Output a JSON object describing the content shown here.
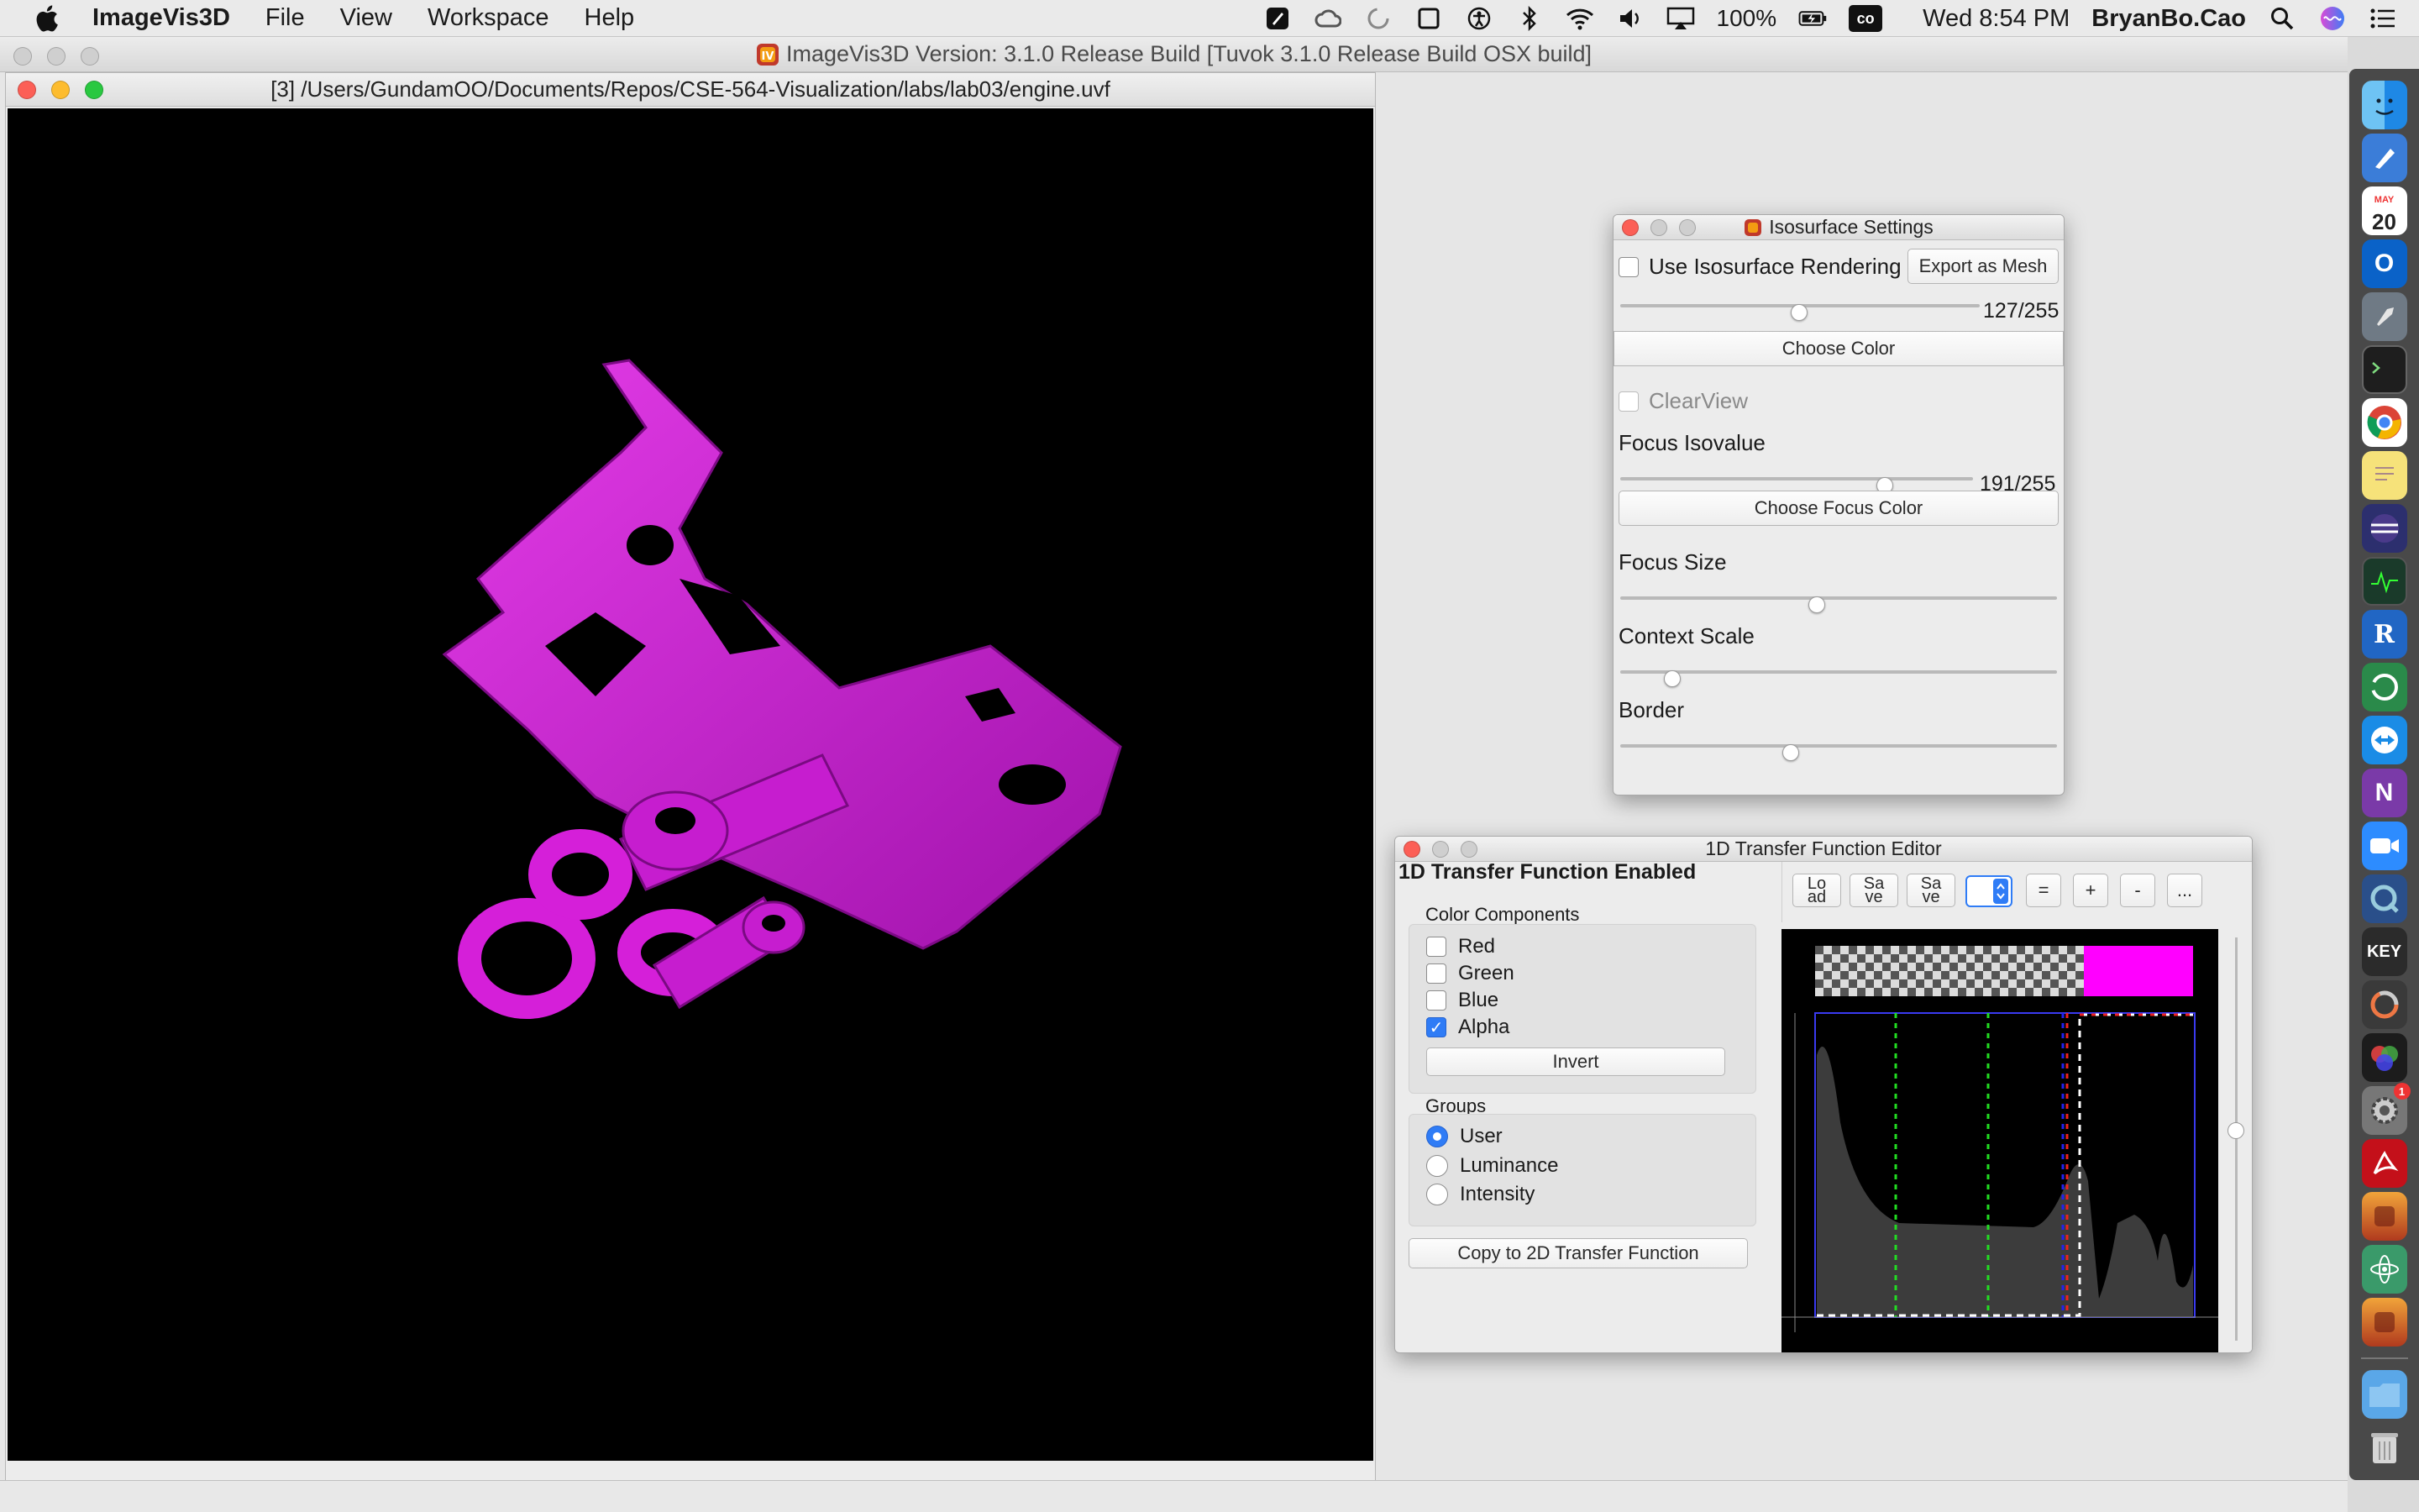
{
  "menubar": {
    "app_name": "ImageVis3D",
    "menus": [
      "File",
      "View",
      "Workspace",
      "Help"
    ],
    "battery": "100%",
    "clock": "Wed 8:54 PM",
    "user": "BryanBo.Cao",
    "keyboard_badge": "co"
  },
  "main_window": {
    "title": "ImageVis3D Version: 3.1.0 Release Build [Tuvok 3.1.0 Release Build OSX build]",
    "render_title": "[3] /Users/GundamOO/Documents/Repos/CSE-564-Visualization/labs/lab03/engine.uvf"
  },
  "isosurface": {
    "title": "Isosurface Settings",
    "use_iso_label": "Use Isosurface Rendering",
    "use_iso_checked": false,
    "export_label": "Export as Mesh",
    "iso_value_text": "127/255",
    "iso_fraction": 0.498,
    "choose_color_label": "Choose Color",
    "clearview_label": "ClearView",
    "focus_iso_label": "Focus Isovalue",
    "focus_iso_value_text": "191/255",
    "focus_iso_fraction": 0.749,
    "choose_focus_color_label": "Choose Focus Color",
    "focus_size_label": "Focus Size",
    "focus_size_fraction": 0.45,
    "context_scale_label": "Context Scale",
    "context_scale_fraction": 0.12,
    "border_label": "Border",
    "border_fraction": 0.39
  },
  "tf_editor": {
    "title": "1D Transfer Function Editor",
    "enabled_label": "1D Transfer Function Enabled",
    "color_components_label": "Color Components",
    "components": [
      {
        "label": "Red",
        "checked": false
      },
      {
        "label": "Green",
        "checked": false
      },
      {
        "label": "Blue",
        "checked": false
      },
      {
        "label": "Alpha",
        "checked": true
      }
    ],
    "invert_label": "Invert",
    "groups_label": "Groups",
    "groups": [
      {
        "label": "User",
        "selected": true
      },
      {
        "label": "Luminance",
        "selected": false
      },
      {
        "label": "Intensity",
        "selected": false
      }
    ],
    "copy_label": "Copy to 2D Transfer Function",
    "toolbar": {
      "load": "Lo ad",
      "save1": "Sa ve",
      "save2": "Sa ve",
      "equal": "=",
      "plus": "+",
      "minus": "-",
      "more": "..."
    },
    "swatch_color": "#ff00ff"
  },
  "colors": {
    "engine": "#c81fd0",
    "accent": "#2f7cf6"
  },
  "dock": {
    "calendar_day": "20",
    "calendar_month": "MAY",
    "outlook_letter": "O",
    "r_letter": "R",
    "onenote_letter": "N",
    "keynote_label": "KEY",
    "badge_count": "1"
  }
}
